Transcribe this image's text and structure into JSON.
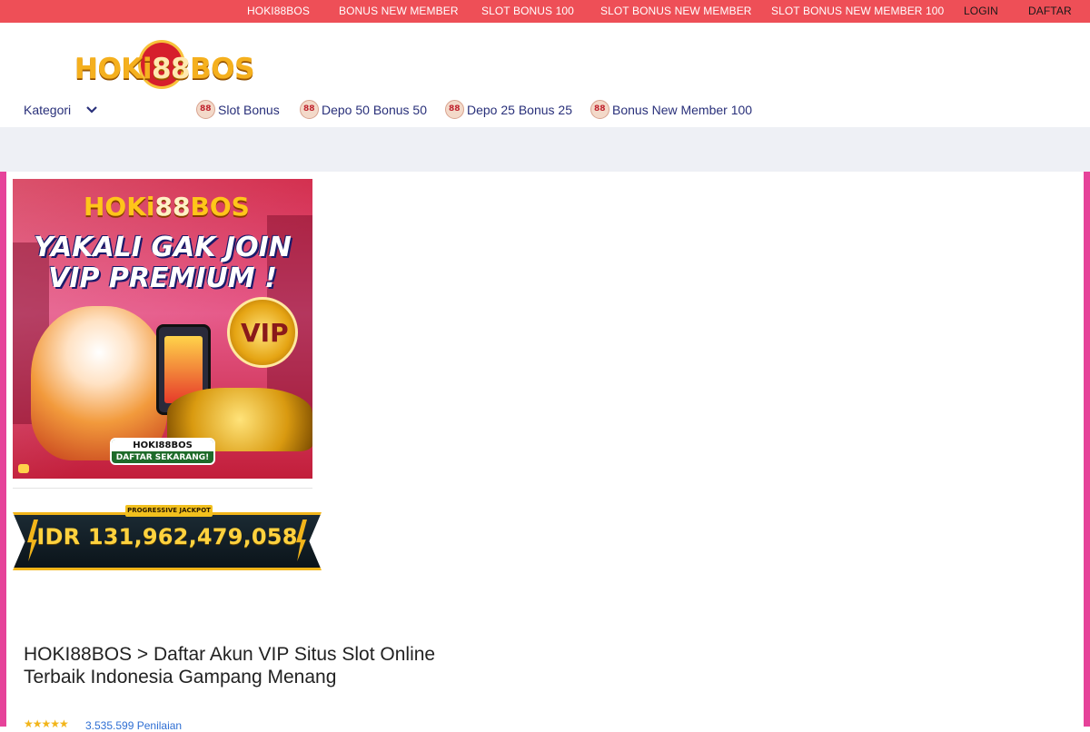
{
  "topbar": {
    "background": "#ee4f57",
    "links": [
      {
        "label": "HOKI88BOS"
      },
      {
        "label": "BONUS NEW MEMBER"
      },
      {
        "label": "SLOT BONUS 100"
      },
      {
        "label": "SLOT BONUS NEW MEMBER"
      },
      {
        "label": "SLOT BONUS NEW MEMBER 100"
      },
      {
        "label": "LOGIN"
      },
      {
        "label": "DAFTAR"
      }
    ]
  },
  "header": {
    "logo_text": {
      "left": "HOKi",
      "mid": "88",
      "right": "BOS"
    },
    "kategori_label": "Kategori",
    "nav": [
      {
        "label": "Slot Bonus",
        "icon": "hoki88-badge-icon"
      },
      {
        "label": "Depo 50 Bonus 50",
        "icon": "hoki88-badge-icon"
      },
      {
        "label": "Depo 25 Bonus 25",
        "icon": "hoki88-badge-icon"
      },
      {
        "label": "Bonus New Member 100",
        "icon": "hoki88-badge-icon"
      }
    ]
  },
  "banner": {
    "logo": {
      "left": "HOKi",
      "mid": "88",
      "right": "BOS"
    },
    "headline_1": "YAKALI GAK JOIN",
    "headline_2": "VIP PREMIUM !",
    "vip_badge": "VIP",
    "search_pill_text": "HOKI88BOS",
    "cta_text": "DAFTAR SEKARANG!"
  },
  "jackpot": {
    "tag": "PROGRESSIVE JACKPOT",
    "amount": "IDR 131,962,479,058"
  },
  "page": {
    "title": "HOKI88BOS > Daftar Akun VIP Situs Slot Online Terbaik Indonesia Gampang Menang",
    "rating_stars": "★★★★★",
    "rating_count": "3.535.599 Penilaian"
  },
  "colors": {
    "accent_red": "#ee4f57",
    "frame_pink": "#e6439a",
    "nav_text": "#29307a",
    "subbar": "#eef0f5"
  }
}
